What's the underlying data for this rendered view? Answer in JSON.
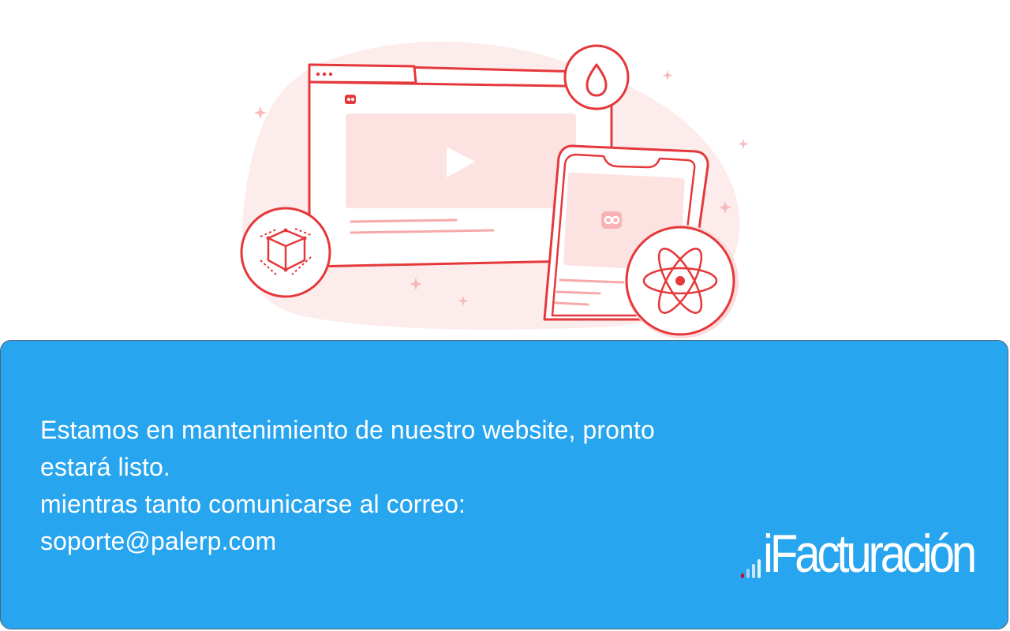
{
  "message": {
    "lines": [
      "Estamos en mantenimiento  de nuestro website, pronto",
      "estará listo.",
      "mientras tanto comunicarse al correo:",
      "soporte@palerp.com"
    ]
  },
  "brand": {
    "name": "iFacturación"
  },
  "illustration": {
    "icons": [
      "browser-window-icon",
      "play-icon",
      "drop-icon",
      "cube-icon",
      "phone-icon",
      "atom-icon",
      "logo-badge-icon"
    ]
  },
  "colors": {
    "panel": "#28a5ef",
    "illustration_red": "#e5383b",
    "illustration_blob": "#fde9e9",
    "text": "#ffffff",
    "brand_dot": "#c8102e"
  }
}
